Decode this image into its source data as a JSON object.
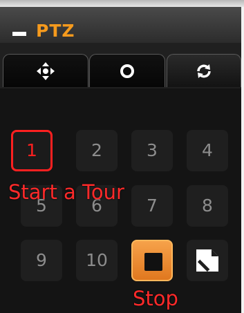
{
  "title": "PTZ",
  "tabs": [
    {
      "icon": "move-arrows-icon"
    },
    {
      "icon": "target-circle-icon"
    },
    {
      "icon": "refresh-cycle-icon",
      "active": true
    }
  ],
  "tour_buttons": [
    "1",
    "2",
    "3",
    "4",
    "5",
    "6",
    "7",
    "8",
    "9",
    "10"
  ],
  "selected_tour": "1",
  "annotations": {
    "start_tour": "Start a Tour",
    "stop": "Stop"
  },
  "colors": {
    "accent": "#f59a1d",
    "highlight": "#ff2020",
    "stop_button": "#e98a2e"
  }
}
